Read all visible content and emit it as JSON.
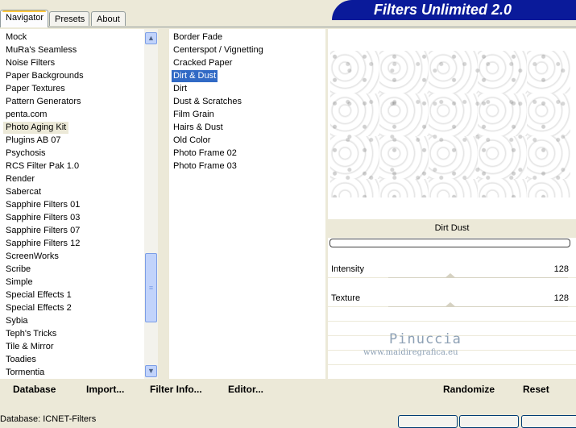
{
  "tabs": [
    "Navigator",
    "Presets",
    "About"
  ],
  "app_title": "Filters Unlimited 2.0",
  "categories": [
    "Mock",
    "MuRa's Seamless",
    "Noise Filters",
    "Paper Backgrounds",
    "Paper Textures",
    "Pattern Generators",
    "penta.com",
    "Photo Aging Kit",
    "Plugins AB 07",
    "Psychosis",
    "RCS Filter Pak 1.0",
    "Render",
    "Sabercat",
    "Sapphire Filters 01",
    "Sapphire Filters 03",
    "Sapphire Filters 07",
    "Sapphire Filters 12",
    "ScreenWorks",
    "Scribe",
    "Simple",
    "Special Effects 1",
    "Special Effects 2",
    "Sybia",
    "Teph's Tricks",
    "Tile & Mirror",
    "Toadies",
    "Tormentia"
  ],
  "selected_category": "Photo Aging Kit",
  "filters": [
    "Border Fade",
    "Centerspot / Vignetting",
    "Cracked Paper",
    "Dirt & Dust",
    "Dirt",
    "Dust & Scratches",
    "Film Grain",
    "Hairs & Dust",
    "Old Color",
    "Photo Frame 02",
    "Photo Frame 03"
  ],
  "selected_filter": "Dirt & Dust",
  "preview": {
    "filter_title": "Dirt  Dust",
    "params": [
      {
        "label": "Intensity",
        "value": "128"
      },
      {
        "label": "Texture",
        "value": "128"
      }
    ]
  },
  "buttons": {
    "database": "Database",
    "import": "Import...",
    "filter_info": "Filter Info...",
    "editor": "Editor...",
    "randomize": "Randomize",
    "reset": "Reset"
  },
  "status": {
    "database": "Database:   ICNET-Filters"
  },
  "watermark": {
    "line1": "Pinuccia",
    "line2": "www.maidiregrafica.eu"
  },
  "colors": {
    "banner": "#0a1a9a",
    "selection": "#316ac5",
    "face": "#ece9d8"
  }
}
